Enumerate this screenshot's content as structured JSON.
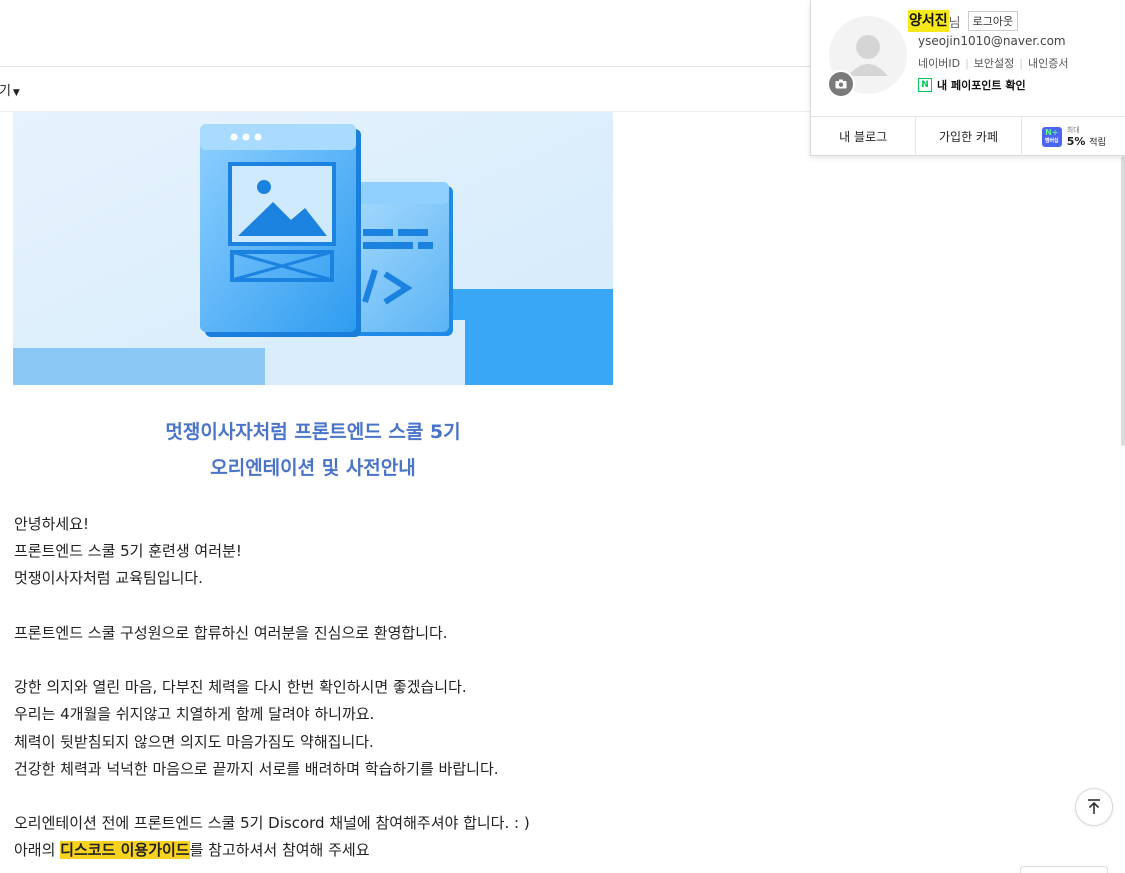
{
  "toolbar": {
    "view_label": "보기"
  },
  "mail": {
    "title_line1": "멋쟁이사자처럼 프론트엔드 스쿨 5기",
    "title_line2": "오리엔테이션 및 사전안내",
    "paragraphs": [
      "안녕하세요!",
      "프론트엔드 스쿨 5기 훈련생 여러분!",
      "멋쟁이사자처럼 교육팀입니다.",
      "프론트엔드 스쿨 구성원으로 합류하신 여러분을 진심으로 환영합니다.",
      "강한 의지와 열린 마음, 다부진 체력을 다시 한번 확인하시면 좋겠습니다.",
      "우리는 4개월을 쉬지않고 치열하게 함께 달려야 하니까요.",
      "체력이 뒷받침되지 않으면 의지도 마음가짐도 약해집니다.",
      "건강한 체력과 넉넉한 마음으로 끝까지 서로를 배려하며 학습하기를 바랍니다.",
      "오리엔테이션 전에 프론트엔드 스쿨 5기 Discord 채널에 참여해주셔야 합니다. : )"
    ],
    "last_line_prefix": "아래의 ",
    "last_line_highlight": "디스코드 이용가이드",
    "last_line_suffix": "를 참고하셔서 참여해 주세요"
  },
  "profile": {
    "name": "양서진",
    "honorific": "님",
    "logout_label": "로그아웃",
    "email": "yseojin1010@naver.com",
    "links": [
      "네이버ID",
      "보안설정",
      "내인증서"
    ],
    "pay_label": "내 페이포인트 확인",
    "pay_badge": "N",
    "tabs": [
      "내 블로그",
      "가입한 카페"
    ],
    "nplus_top": "N+",
    "nplus_bottom": "멤버십",
    "save_max": "최대",
    "save_percent": "5%",
    "save_suffix": "적립"
  },
  "colors": {
    "title": "#4a74c9",
    "highlight": "#f7d21e",
    "name_highlight": "#f7e81a",
    "npay_green": "#03c75a",
    "nplus_blue": "#4b64f2"
  },
  "icons": {
    "scroll_top": "arrow-up-to-top-icon",
    "camera": "camera-icon",
    "avatar": "default-avatar"
  }
}
